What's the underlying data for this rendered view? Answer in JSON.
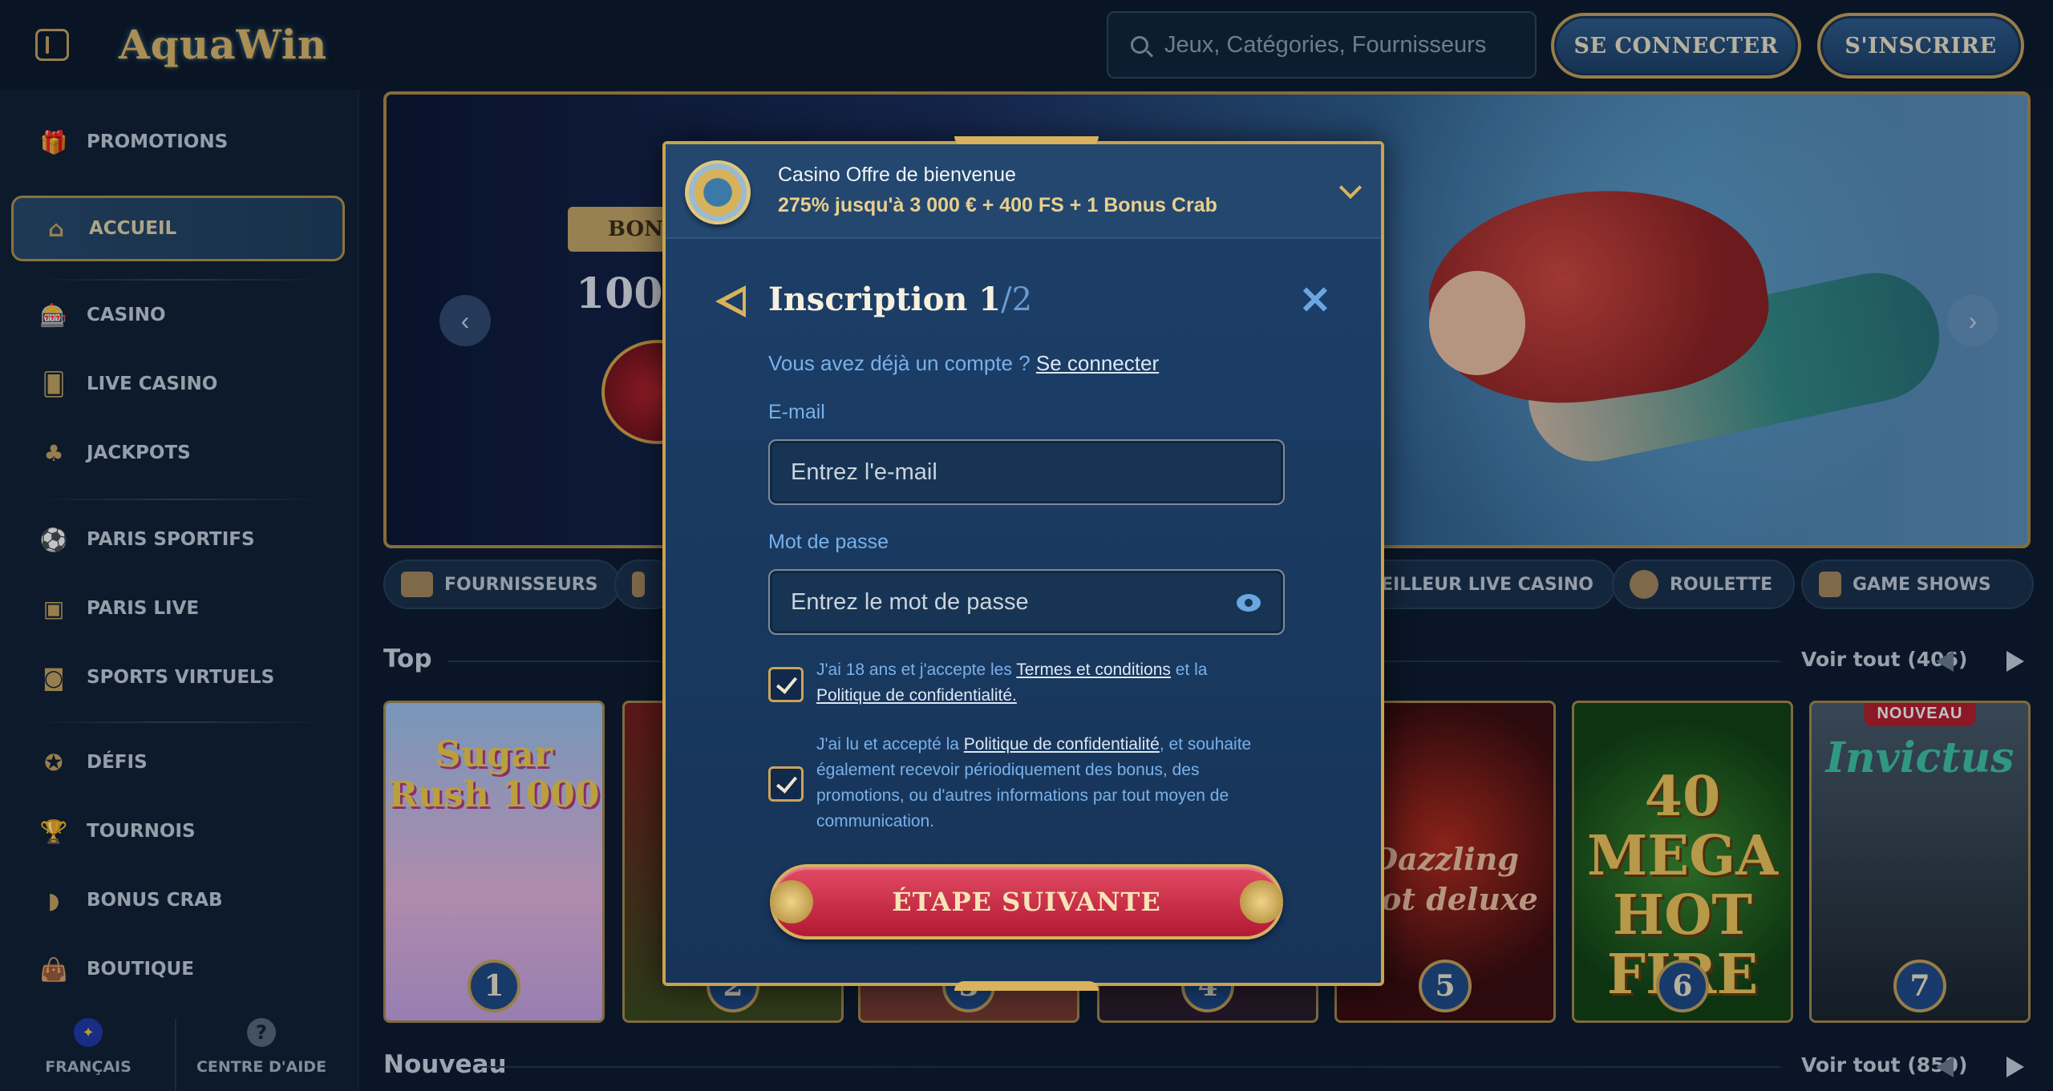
{
  "header": {
    "logo": "AquaWin",
    "search_placeholder": "Jeux, Catégories, Fournisseurs",
    "login_label": "SE CONNECTER",
    "register_label": "S'INSCRIRE"
  },
  "sidebar": {
    "items": [
      {
        "label": "PROMOTIONS",
        "icon": "gift-icon",
        "glyph": "🎁"
      },
      {
        "label": "ACCUEIL",
        "icon": "home-icon",
        "glyph": "⌂",
        "active": true
      },
      {
        "label": "CASINO",
        "icon": "slot-machine-icon",
        "glyph": "🎰"
      },
      {
        "label": "LIVE CASINO",
        "icon": "live-card-icon",
        "glyph": "🂠"
      },
      {
        "label": "JACKPOTS",
        "icon": "clover-icon",
        "glyph": "♣"
      },
      {
        "label": "PARIS SPORTIFS",
        "icon": "soccer-ball-icon",
        "glyph": "⚽"
      },
      {
        "label": "PARIS LIVE",
        "icon": "live-badge-icon",
        "glyph": "▣"
      },
      {
        "label": "SPORTS VIRTUELS",
        "icon": "virtual-sports-icon",
        "glyph": "◙"
      },
      {
        "label": "DÉFIS",
        "icon": "challenge-icon",
        "glyph": "✪"
      },
      {
        "label": "TOURNOIS",
        "icon": "trophy-icon",
        "glyph": "🏆"
      },
      {
        "label": "BONUS CRAB",
        "icon": "crab-claw-icon",
        "glyph": "◗"
      },
      {
        "label": "BOUTIQUE",
        "icon": "shopping-bag-icon",
        "glyph": "👜"
      }
    ],
    "footer": {
      "language": "FRANÇAIS",
      "help": "CENTRE D'AIDE",
      "help_glyph": "?"
    }
  },
  "banner": {
    "badge": "BONU",
    "percent": "100 %"
  },
  "chips": [
    {
      "label": "FOURNISSEURS"
    },
    {
      "label": ""
    },
    {
      "label": "EILLEUR LIVE CASINO"
    },
    {
      "label": "ROULETTE"
    },
    {
      "label": "GAME SHOWS"
    }
  ],
  "sections": {
    "top": {
      "title": "Top",
      "more": "Voir tout (406)"
    },
    "new": {
      "title": "Nouveau",
      "more": "Voir tout (850)"
    }
  },
  "games": [
    {
      "name": "Sugar Rush 1000",
      "rank": "1"
    },
    {
      "name": "",
      "rank": "2"
    },
    {
      "name": "",
      "rank": "3"
    },
    {
      "name": "",
      "rank": "4"
    },
    {
      "name": "Dazzling Hot deluxe",
      "rank": "5"
    },
    {
      "name": "40 MEGA HOT FIRE",
      "rank": "6"
    },
    {
      "name": "Invictus",
      "rank": "7",
      "tag": "NOUVEAU"
    }
  ],
  "modal": {
    "offer_title": "Casino Offre de bienvenue",
    "offer_sub": "275% jusqu'à 3 000 € + 400 FS + 1 Bonus Crab",
    "title": "Inscription 1",
    "title_step": "/2",
    "have_account": "Vous avez déjà un compte ?",
    "login_link": "Se connecter",
    "email_label": "E-mail",
    "email_placeholder": "Entrez l'e-mail",
    "password_label": "Mot de passe",
    "password_placeholder": "Entrez le mot de passe",
    "terms_1": "J'ai 18 ans et j'accepte les",
    "terms_link": "Termes et conditions",
    "terms_2": "et la",
    "privacy_link": "Politique de confidentialité.",
    "consent_1": "J'ai lu et accepté la",
    "consent_link": "Politique de confidentialité",
    "consent_2": ", et souhaite également recevoir périodiquement des bonus, des promotions, ou d'autres informations par tout moyen de communication.",
    "cta": "ÉTAPE SUIVANTE"
  },
  "colors": {
    "accent_gold": "#c9a35a",
    "bg": "#0c1a2c",
    "modal_blue": "#1d4068",
    "cta_red": "#c8263f"
  }
}
